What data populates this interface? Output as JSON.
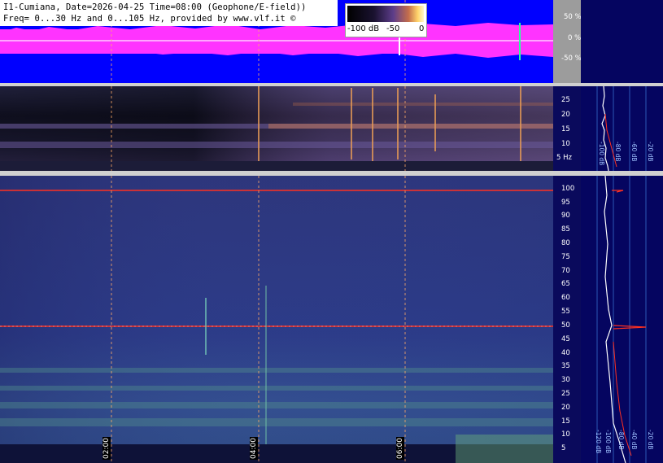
{
  "title": {
    "line1": "I1-Cumiana, Date=2026-04-25 Time=08:00 (Geophone/E-field))",
    "line2": "Freq= 0...30 Hz and 0...105 Hz, provided by www.vlf.it ©"
  },
  "colorbar": {
    "labels": [
      "-100 dB",
      "-50",
      "0"
    ]
  },
  "time_labels": [
    "02:00",
    "04:00",
    "06:00"
  ],
  "chart_data": [
    {
      "type": "line",
      "title": "",
      "ylabel": "",
      "yticks": [
        "50 %",
        "0 %",
        "-50 %"
      ],
      "ylim": [
        -75,
        75
      ]
    },
    {
      "type": "heatmap",
      "yticks": [
        "25",
        "20",
        "15",
        "10",
        "5 Hz"
      ],
      "ylim": [
        0,
        30
      ]
    },
    {
      "type": "heatmap",
      "yticks": [
        "100",
        "95",
        "90",
        "85",
        "80",
        "75",
        "70",
        "65",
        "60",
        "55",
        "50",
        "45",
        "40",
        "35",
        "30",
        "25",
        "20",
        "15",
        "10",
        "5"
      ],
      "ylim": [
        0,
        105
      ],
      "x": [
        "02:00",
        "04:00",
        "06:00"
      ]
    },
    {
      "type": "line",
      "xticks_top": [
        "-100 dB",
        "-80 dB",
        "-60 dB",
        "-20 dB"
      ],
      "xticks_bottom": [
        "-120 dB",
        "-100 dB",
        "-80 dB",
        "-40 dB",
        "-20 dB"
      ]
    }
  ],
  "colors": {
    "background": "#0000ff",
    "signal": "#ff33ff",
    "spectrogram_high": "#2a3a86",
    "marker_line": "#ff6a3d",
    "mains_line": "#ff3020",
    "side_panel": "#0a0a5c",
    "axis_panel": "#9c9c9c"
  }
}
